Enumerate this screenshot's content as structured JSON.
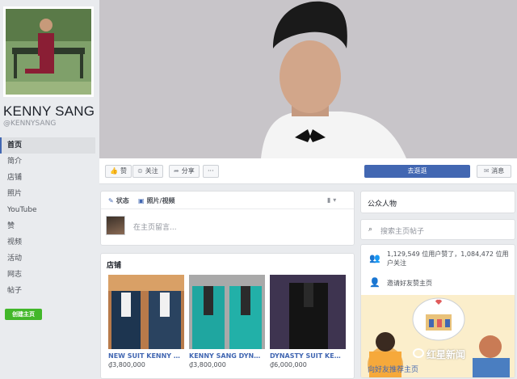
{
  "profile": {
    "name": "KENNY SANG",
    "handle": "@KENNYSANG"
  },
  "nav": {
    "items": [
      {
        "label": "首页",
        "active": true
      },
      {
        "label": "简介"
      },
      {
        "label": "店铺"
      },
      {
        "label": "照片"
      },
      {
        "label": "YouTube"
      },
      {
        "label": "赞"
      },
      {
        "label": "视频"
      },
      {
        "label": "活动"
      },
      {
        "label": "网志"
      },
      {
        "label": "帖子"
      }
    ],
    "create_page": "创建主页"
  },
  "cover_actions": {
    "like": "赞",
    "follow": "关注",
    "share": "分享",
    "more": "···",
    "primary": "去逛逛",
    "message": "消息"
  },
  "composer": {
    "status_tab": "状态",
    "photo_tab": "照片/视频",
    "placeholder": "在主页留言..."
  },
  "shop": {
    "title": "店铺",
    "products": [
      {
        "name": "NEW SUIT KENNY SA...",
        "price": "₫3,800,000"
      },
      {
        "name": "KENNY SANG DYNAS...",
        "price": "₫3,800,000"
      },
      {
        "name": "DYNASTY SUIT KENN...",
        "price": "₫6,000,000"
      }
    ]
  },
  "sidebar": {
    "category": "公众人物",
    "search_placeholder": "搜索主页帖子",
    "stats_text": "1,129,549 位用户赞了，1,084,472 位用户关注",
    "invite_text": "邀请好友赞主页",
    "invite_link": "向好友推荐主页"
  },
  "watermark": "红星新闻",
  "colors": {
    "accent": "#4267b2",
    "create": "#42b72a",
    "bg": "#e9ebee"
  }
}
